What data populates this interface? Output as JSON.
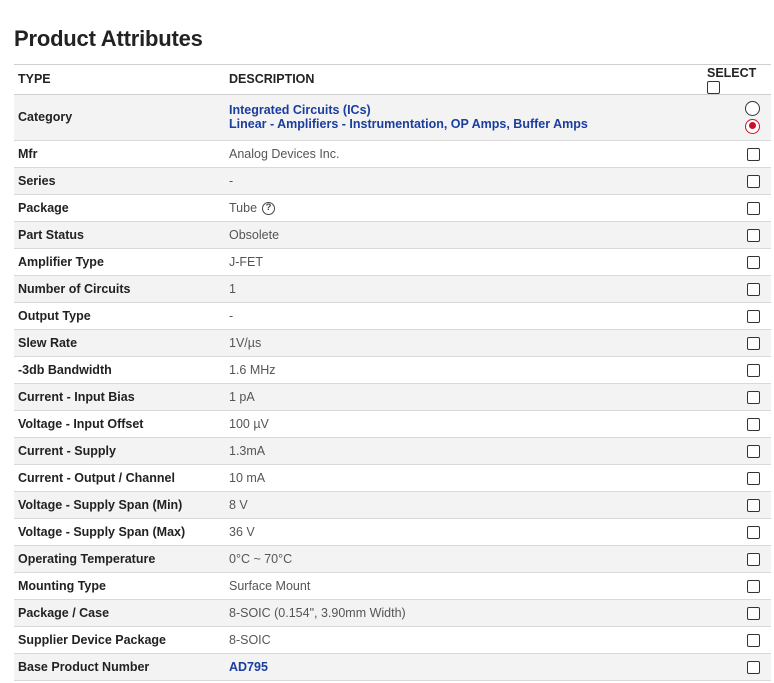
{
  "title": "Product Attributes",
  "headers": {
    "type": "TYPE",
    "description": "DESCRIPTION",
    "select": "SELECT"
  },
  "category": {
    "type": "Category",
    "level1": "Integrated Circuits (ICs)",
    "level2": "Linear - Amplifiers - Instrumentation, OP Amps, Buffer Amps"
  },
  "rows": [
    {
      "type": "Mfr",
      "description": "Analog Devices Inc."
    },
    {
      "type": "Series",
      "description": "-"
    },
    {
      "type": "Package",
      "description": "Tube"
    },
    {
      "type": "Part Status",
      "description": "Obsolete"
    },
    {
      "type": "Amplifier Type",
      "description": "J-FET"
    },
    {
      "type": "Number of Circuits",
      "description": "1"
    },
    {
      "type": "Output Type",
      "description": "-"
    },
    {
      "type": "Slew Rate",
      "description": "1V/µs"
    },
    {
      "type": "-3db Bandwidth",
      "description": "1.6 MHz"
    },
    {
      "type": "Current - Input Bias",
      "description": "1 pA"
    },
    {
      "type": "Voltage - Input Offset",
      "description": "100 µV"
    },
    {
      "type": "Current - Supply",
      "description": "1.3mA"
    },
    {
      "type": "Current - Output / Channel",
      "description": "10 mA"
    },
    {
      "type": "Voltage - Supply Span (Min)",
      "description": "8 V"
    },
    {
      "type": "Voltage - Supply Span (Max)",
      "description": "36 V"
    },
    {
      "type": "Operating Temperature",
      "description": "0°C ~ 70°C"
    },
    {
      "type": "Mounting Type",
      "description": "Surface Mount"
    },
    {
      "type": "Package / Case",
      "description": "8-SOIC (0.154\", 3.90mm Width)"
    },
    {
      "type": "Supplier Device Package",
      "description": "8-SOIC"
    },
    {
      "type": "Base Product Number",
      "description": "AD795"
    }
  ],
  "help_glyph": "?",
  "icons": {
    "help": "question-circle-icon",
    "checkbox": "checkbox-empty",
    "radio_selected": "radio-selected"
  },
  "colors": {
    "link": "#1a3d9e",
    "radio_accent": "#c8102e",
    "stripe": "#f3f3f3"
  }
}
